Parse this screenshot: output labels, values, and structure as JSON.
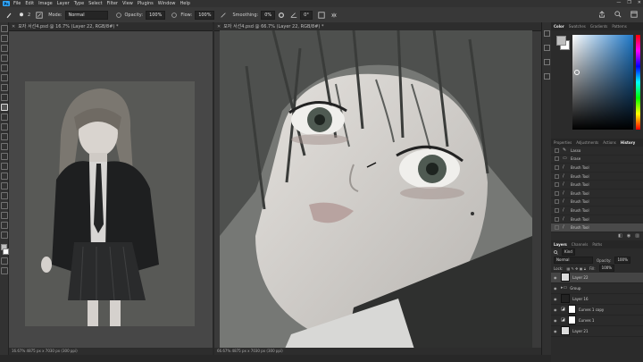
{
  "menu": {
    "logo": "Ps",
    "items": [
      "File",
      "Edit",
      "Image",
      "Layer",
      "Type",
      "Select",
      "Filter",
      "View",
      "Plugins",
      "Window",
      "Help"
    ],
    "window_controls": [
      "—",
      "❐",
      "✕"
    ]
  },
  "options": {
    "brush_size": "2",
    "mode_label": "Mode:",
    "mode_value": "Normal",
    "opacity_label": "Opacity:",
    "opacity_value": "100%",
    "flow_label": "Flow:",
    "flow_value": "100%",
    "smoothing_label": "Smoothing:",
    "smoothing_value": "0%",
    "angle_value": "0°"
  },
  "docs": {
    "left_tab": "모자 서선4.psd @ 16.7% (Layer 22, RGB/8#) *",
    "right_tab": "모자 서선4.psd @ 66.7% (Layer 22, RGB/8#) *",
    "left_status": "16.67%    4875 px x 7030 px (300 ppi)",
    "right_status": "66.67%   4875 px x 7030 px (300 ppi)"
  },
  "color_panel": {
    "tabs": [
      "Color",
      "Swatches",
      "Gradients",
      "Patterns"
    ],
    "accent": "#1e78c8"
  },
  "history_panel": {
    "tabs": [
      "Properties",
      "Adjustments",
      "Actions",
      "History"
    ],
    "rows": [
      "Lasso",
      "Erase",
      "Brush Tool",
      "Brush Tool",
      "Brush Tool",
      "Brush Tool",
      "Brush Tool",
      "Brush Tool",
      "Brush Tool",
      "Brush Tool"
    ]
  },
  "layers_panel": {
    "tabs": [
      "Layers",
      "Channels",
      "Paths"
    ],
    "kind": "Kind",
    "blend": "Normal",
    "opacity_label": "Opacity:",
    "opacity_value": "100%",
    "lock_label": "Lock:",
    "fill_label": "Fill:",
    "fill_value": "100%",
    "layers": [
      {
        "name": "Layer 22",
        "thumb": "light",
        "selected": true
      },
      {
        "name": "Group",
        "thumb": "folder",
        "selected": false
      },
      {
        "name": "Layer 16",
        "thumb": "dark",
        "selected": false
      },
      {
        "name": "Curves 1 copy",
        "thumb": "adj",
        "selected": false
      },
      {
        "name": "Curves 1",
        "thumb": "adj",
        "selected": false
      },
      {
        "name": "Layer 21",
        "thumb": "light",
        "selected": false
      }
    ]
  }
}
